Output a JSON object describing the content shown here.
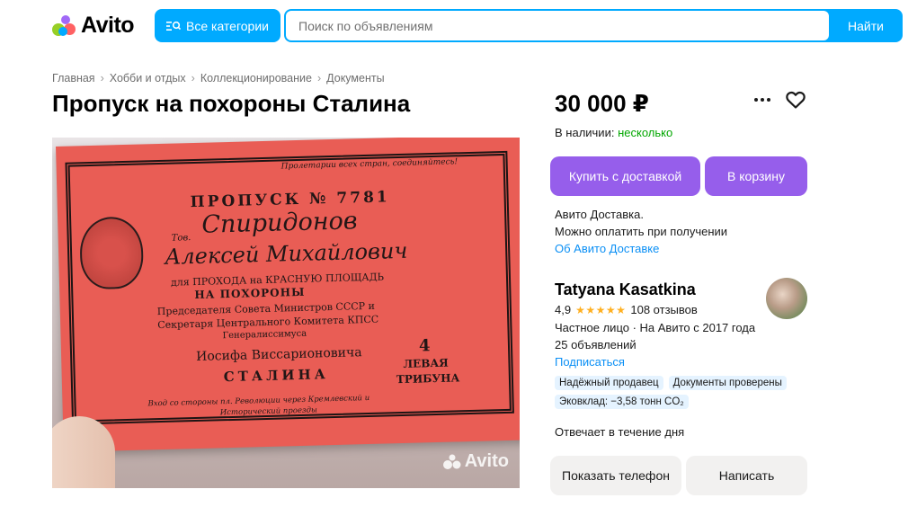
{
  "header": {
    "logo_text": "Avito",
    "categories_label": "Все категории",
    "search_placeholder": "Поиск по объявлениям",
    "search_button": "Найти",
    "colors": {
      "brand": "#00aaff"
    }
  },
  "breadcrumb": [
    "Главная",
    "Хобби и отдых",
    "Коллекционирование",
    "Документы"
  ],
  "listing": {
    "title": "Пропуск на похороны Сталина",
    "photo_watermark": "Avito"
  },
  "offer": {
    "price": "30 000 ₽",
    "stock_label": "В наличии:",
    "stock_value": "несколько",
    "buy_button": "Купить с доставкой",
    "cart_button": "В корзину",
    "delivery_line1": "Авито Доставка.",
    "delivery_line2": "Можно оплатить при получении",
    "delivery_link": "Об Авито Доставке",
    "colors": {
      "accent": "#965eeb",
      "in_stock": "#02a700",
      "link": "#0a8ff5"
    }
  },
  "seller": {
    "name": "Tatyana Kasatkina",
    "rating": "4,9",
    "stars": 5,
    "reviews": "108 отзывов",
    "type_line": "Частное лицо · На Авито с 2017 года",
    "ads_count": "25 объявлений",
    "subscribe": "Подписаться",
    "badges": [
      "Надёжный продавец",
      "Документы проверены",
      "Эковклад: −3,58 тонн CO₂"
    ],
    "reply_time": "Отвечает в течение дня",
    "phone_button": "Показать телефон",
    "write_button": "Написать"
  },
  "ticket": {
    "slogan": "Пролетарии всех стран, соединяйтесь!",
    "heading": "ПРОПУСК № 7781",
    "tov": "Тов.",
    "surname": "Спиридонов",
    "name": "Алексей Михайлович",
    "purpose1": "для ПРОХОДА на КРАСНУЮ ПЛОЩАДЬ",
    "purpose2": "НА ПОХОРОНЫ",
    "role1": "Председателя Совета Министров СССР и",
    "role2": "Секретаря Центрального Комитета КПСС",
    "role3": "Генералиссимуса",
    "person1": "Иосифа Виссарионовича",
    "person2": "СТАЛИНА",
    "stand_number": "4",
    "stand_label1": "ЛЕВАЯ",
    "stand_label2": "ТРИБУНА",
    "footer1": "Вход со стороны пл. Революции через Кремлевский и",
    "footer2": "Исторический проезды"
  }
}
